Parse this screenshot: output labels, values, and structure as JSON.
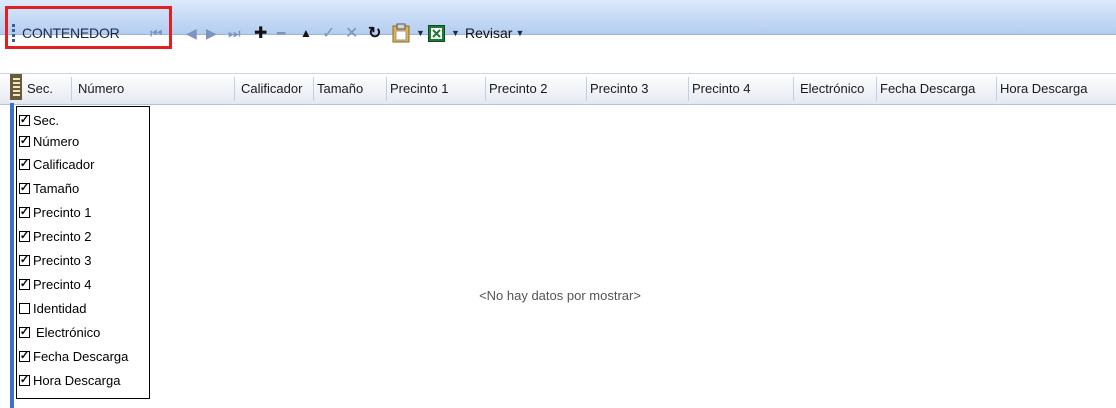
{
  "toolbar": {
    "title": "CONTENEDOR",
    "buttons": [
      {
        "name": "first-record-icon",
        "glyph": "⏮"
      },
      {
        "name": "previous-record-icon",
        "glyph": "◀"
      },
      {
        "name": "next-record-icon",
        "glyph": "▶"
      },
      {
        "name": "last-record-icon",
        "glyph": "⏭"
      },
      {
        "name": "add-icon",
        "glyph": "✚"
      },
      {
        "name": "remove-icon",
        "glyph": "━"
      },
      {
        "name": "move-up-icon",
        "glyph": "▲"
      },
      {
        "name": "confirm-icon",
        "glyph": "✓"
      },
      {
        "name": "cancel-icon",
        "glyph": "✕"
      },
      {
        "name": "refresh-icon",
        "glyph": "↻"
      }
    ],
    "revisar_label": "Revisar",
    "highlight_color": "#e02020"
  },
  "grid": {
    "columns": [
      "Sec.",
      "Número",
      "Calificador",
      "Tamaño",
      "Precinto 1",
      "Precinto 2",
      "Precinto 3",
      "Precinto 4",
      "Electrónico",
      "Fecha Descarga",
      "Hora Descarga"
    ],
    "empty_message": "<No hay datos por mostrar>"
  },
  "column_chooser": {
    "items": [
      {
        "label": "Sec.",
        "checked": true
      },
      {
        "label": "Número",
        "checked": true
      },
      {
        "label": "Calificador",
        "checked": true
      },
      {
        "label": "Tamaño",
        "checked": true
      },
      {
        "label": "Precinto 1",
        "checked": true
      },
      {
        "label": "Precinto 2",
        "checked": true
      },
      {
        "label": "Precinto 3",
        "checked": true
      },
      {
        "label": "Precinto 4",
        "checked": true
      },
      {
        "label": "Identidad",
        "checked": false
      },
      {
        "label": "Electrónico",
        "checked": true
      },
      {
        "label": "Fecha Descarga",
        "checked": true
      },
      {
        "label": "Hora Descarga",
        "checked": true
      }
    ]
  }
}
